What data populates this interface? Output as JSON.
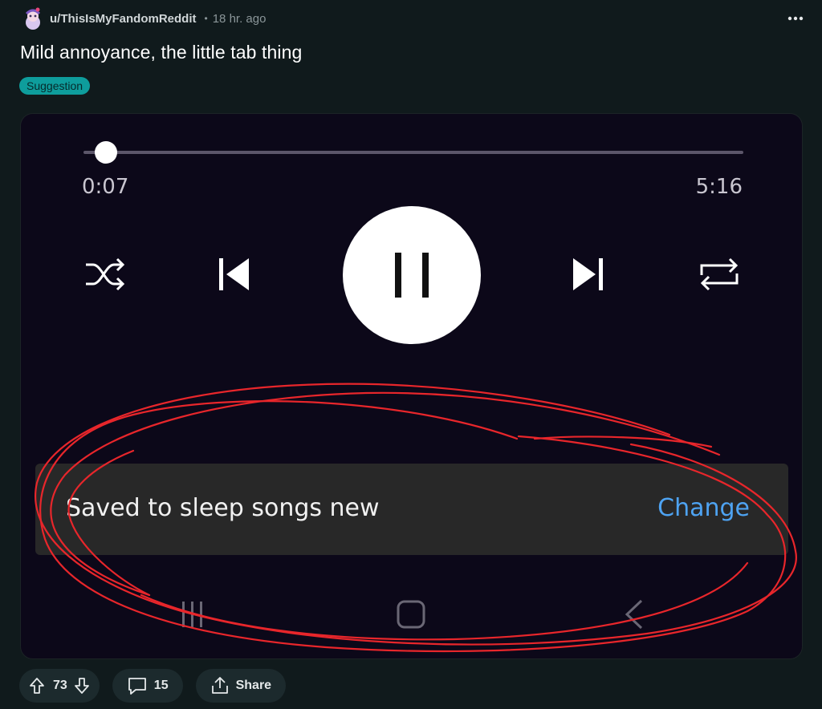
{
  "post": {
    "author": "u/ThisIsMyFandomReddit",
    "separator": "•",
    "time": "18 hr. ago",
    "title": "Mild annoyance, the little tab thing",
    "flair": "Suggestion"
  },
  "player": {
    "current_time": "0:07",
    "total_time": "5:16",
    "progress": 0.022,
    "snackbar_text": "Saved to sleep songs new",
    "snackbar_action": "Change"
  },
  "footer": {
    "votes": "73",
    "comments": "15",
    "share_label": "Share"
  },
  "colors": {
    "flair_bg": "#0e9d9c",
    "action_blue": "#4ea3f2",
    "annotation_red": "#e8262b"
  }
}
